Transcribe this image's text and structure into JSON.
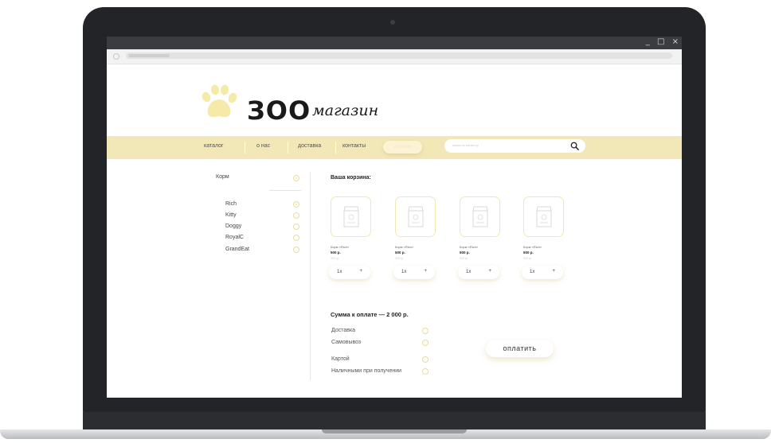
{
  "logo": {
    "big": "ЗОО",
    "small": "магазин"
  },
  "nav": {
    "items": [
      "каталог",
      "о нас",
      "доставка",
      "контакты"
    ],
    "button": "корзина",
    "search_placeholder": "поиск по каталогу"
  },
  "sidebar": {
    "category": "Корм",
    "brands": [
      "Rich",
      "Kitty",
      "Doggy",
      "RoyalC",
      "GrandEat"
    ]
  },
  "cart": {
    "title": "Ваша корзина:",
    "items": [
      {
        "name": "Корм «Rich»",
        "price": "500 р.",
        "weight": "300 гр.",
        "qty": "1x",
        "plus": "+"
      },
      {
        "name": "Корм «Rich»",
        "price": "500 р.",
        "weight": "300 гр.",
        "qty": "1x",
        "plus": "+"
      },
      {
        "name": "Корм «Rich»",
        "price": "500 р.",
        "weight": "300 гр.",
        "qty": "1x",
        "plus": "+"
      },
      {
        "name": "Корм «Rich»",
        "price": "500 р.",
        "weight": "300 гр.",
        "qty": "1x",
        "plus": "+"
      }
    ]
  },
  "summary": {
    "total": "Сумма к оплате —  2 000 р.",
    "delivery": "Доставка",
    "pickup": "Самовывоз",
    "card": "Картой",
    "cash": "Наличными при получении",
    "pay_button": "оплатить"
  },
  "window": {
    "minimize": "_",
    "maximize": "□",
    "close": "×"
  },
  "colors": {
    "accent": "#f2e7b7",
    "paw": "#f6eaa9",
    "frame": "#222428"
  }
}
